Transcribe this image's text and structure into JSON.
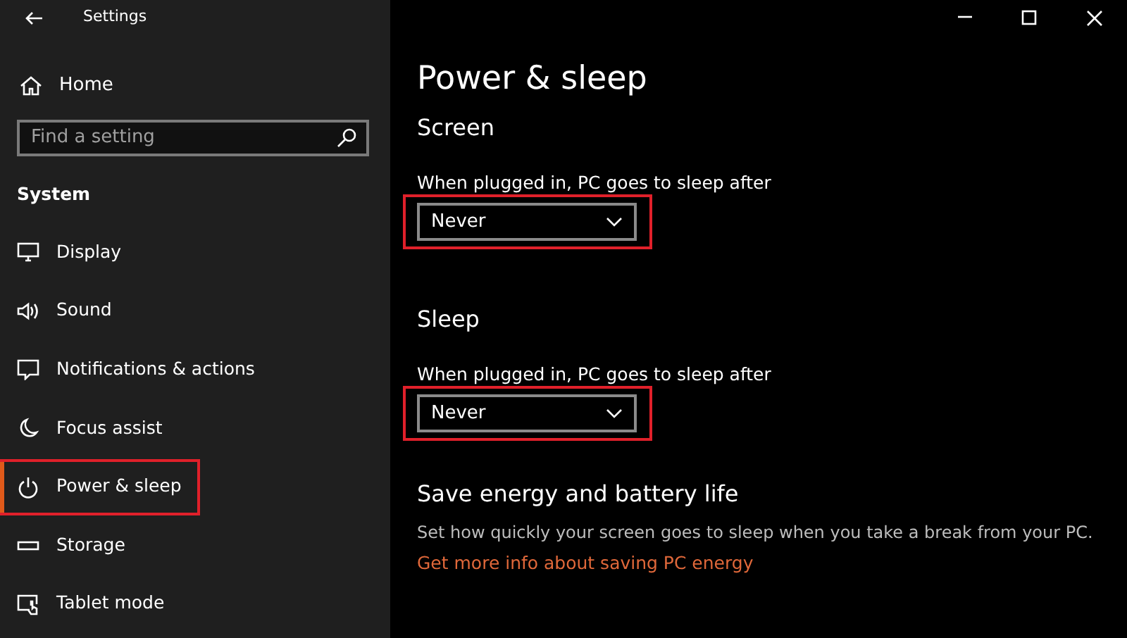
{
  "window": {
    "title": "Settings"
  },
  "sidebar": {
    "home": "Home",
    "search": {
      "placeholder": "Find a setting"
    },
    "section": "System",
    "items": [
      {
        "label": "Display",
        "selected": false,
        "highlighted": false
      },
      {
        "label": "Sound",
        "selected": false,
        "highlighted": false
      },
      {
        "label": "Notifications & actions",
        "selected": false,
        "highlighted": false
      },
      {
        "label": "Focus assist",
        "selected": false,
        "highlighted": false
      },
      {
        "label": "Power & sleep",
        "selected": true,
        "highlighted": true
      },
      {
        "label": "Storage",
        "selected": false,
        "highlighted": false
      },
      {
        "label": "Tablet mode",
        "selected": false,
        "highlighted": false
      }
    ]
  },
  "main": {
    "title": "Power & sleep",
    "sections": [
      {
        "heading": "Screen",
        "label": "When plugged in, PC goes to sleep after",
        "value": "Never",
        "highlighted": true
      },
      {
        "heading": "Sleep",
        "label": "When plugged in, PC goes to sleep after",
        "value": "Never",
        "highlighted": true
      }
    ],
    "info": {
      "heading": "Save energy and battery life",
      "text": "Set how quickly your screen goes to sleep when you take a break from your PC.",
      "link": "Get more info about saving PC energy"
    }
  }
}
